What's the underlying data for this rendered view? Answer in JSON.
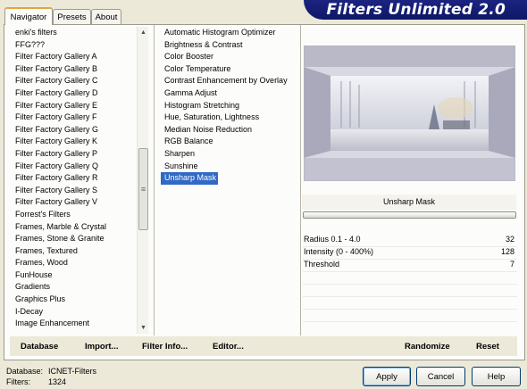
{
  "tabs": [
    "Navigator",
    "Presets",
    "About"
  ],
  "banner_title": "Filters Unlimited 2.0",
  "categories": [
    "enki's filters",
    "FFG???",
    "Filter Factory Gallery A",
    "Filter Factory Gallery B",
    "Filter Factory Gallery C",
    "Filter Factory Gallery D",
    "Filter Factory Gallery E",
    "Filter Factory Gallery F",
    "Filter Factory Gallery G",
    "Filter Factory Gallery K",
    "Filter Factory Gallery P",
    "Filter Factory Gallery Q",
    "Filter Factory Gallery R",
    "Filter Factory Gallery S",
    "Filter Factory Gallery V",
    "Forrest's Filters",
    "Frames, Marble & Crystal",
    "Frames, Stone & Granite",
    "Frames, Textured",
    "Frames, Wood",
    "FunHouse",
    "Gradients",
    "Graphics Plus",
    "I-Decay",
    "Image Enhancement"
  ],
  "filters": [
    "Automatic Histogram Optimizer",
    "Brightness & Contrast",
    "Color Booster",
    "Color Temperature",
    "Contrast Enhancement by Overlay",
    "Gamma Adjust",
    "Histogram Stretching",
    "Hue, Saturation, Lightness",
    "Median Noise Reduction",
    "RGB Balance",
    "Sharpen",
    "Sunshine",
    "Unsharp Mask"
  ],
  "selected_filter": "Unsharp Mask",
  "preview_caption": "Unsharp Mask",
  "params": [
    {
      "label": "Radius 0.1 - 4.0",
      "value": "32"
    },
    {
      "label": "Intensity (0 - 400%)",
      "value": "128"
    },
    {
      "label": "Threshold",
      "value": "7"
    }
  ],
  "toolbar": {
    "database": "Database",
    "import": "Import...",
    "filter_info": "Filter Info...",
    "editor": "Editor...",
    "randomize": "Randomize",
    "reset": "Reset"
  },
  "info": {
    "database_label": "Database:",
    "database_value": "ICNET-Filters",
    "filters_label": "Filters:",
    "filters_value": "1324"
  },
  "buttons": {
    "apply": "Apply",
    "cancel": "Cancel",
    "help": "Help"
  },
  "colors": {
    "selection": "#3169c6",
    "banner": "#141c78"
  }
}
